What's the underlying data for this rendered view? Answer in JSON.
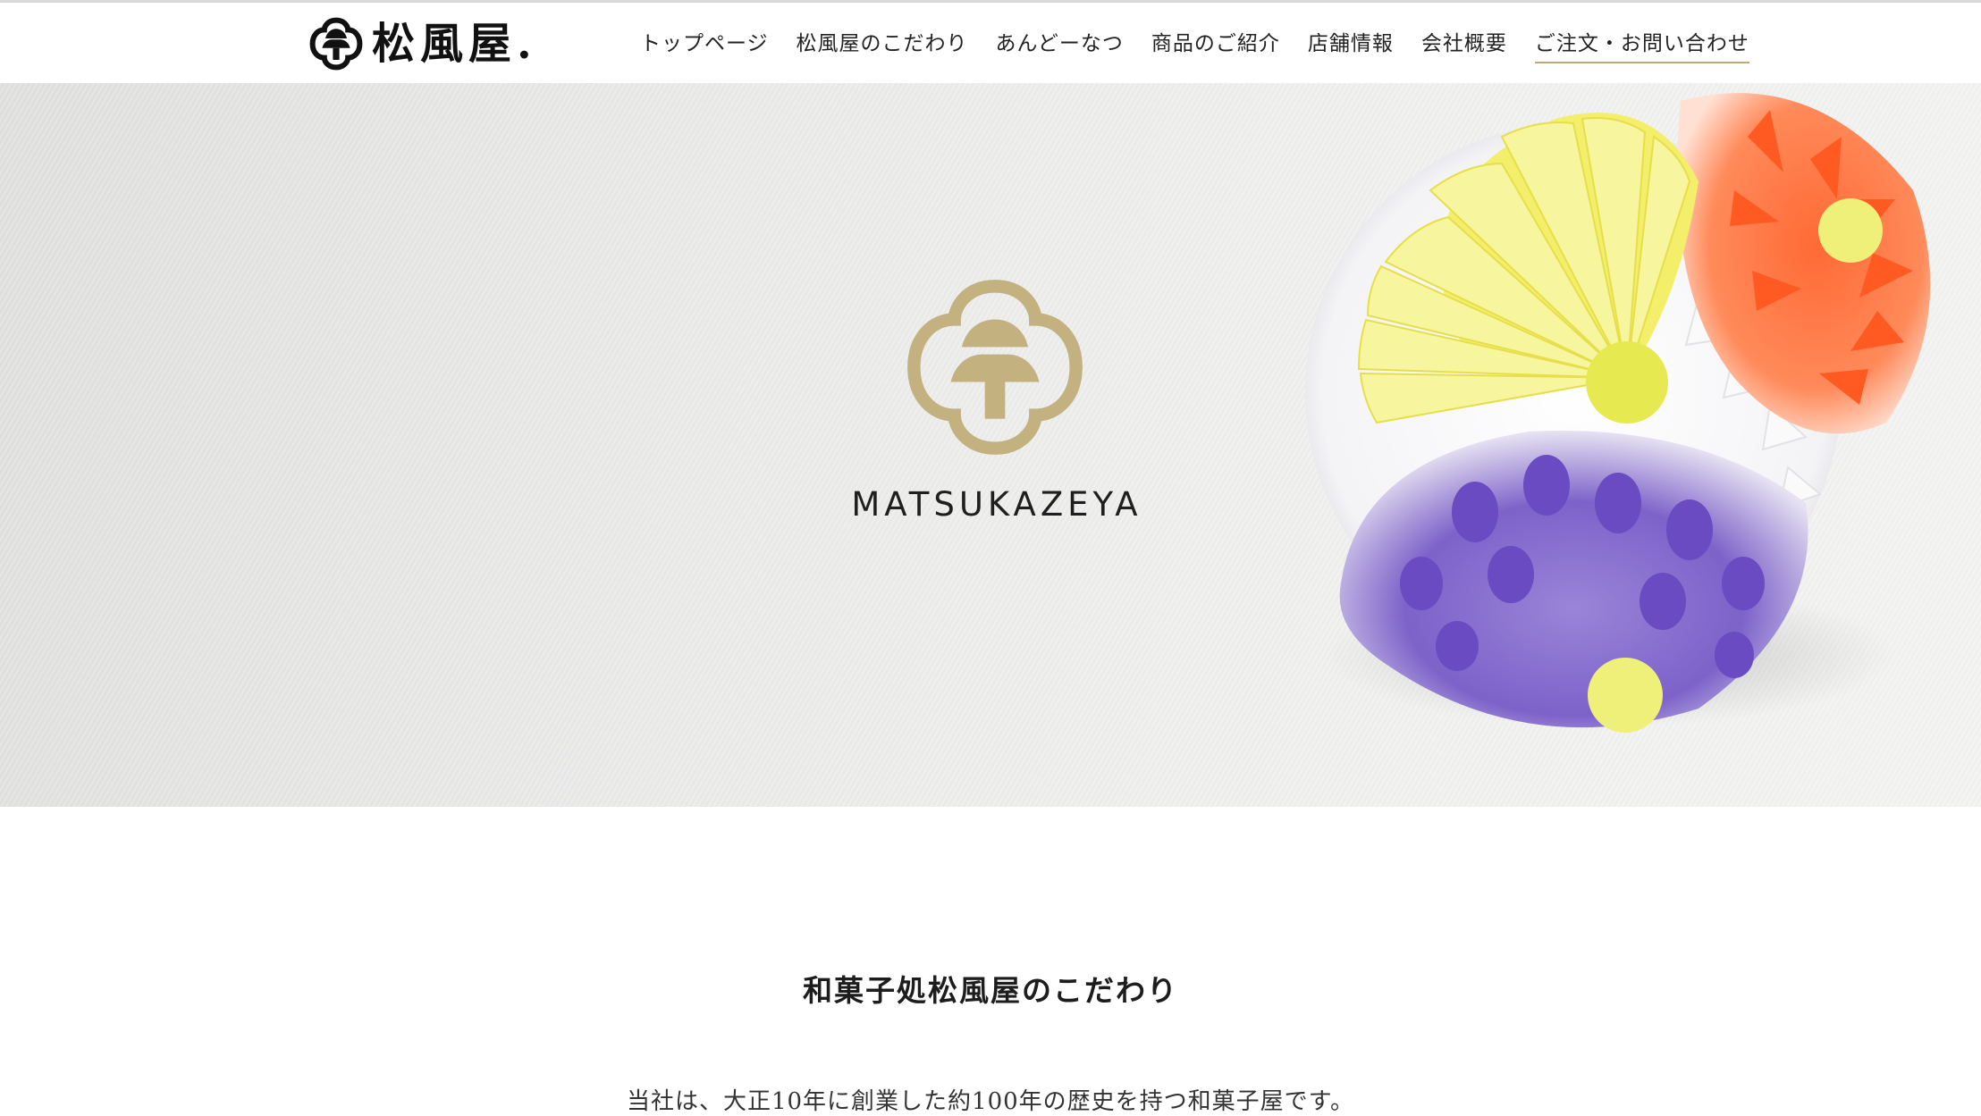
{
  "header": {
    "logo_text": "松風屋.",
    "nav": [
      {
        "label": "トップページ"
      },
      {
        "label": "松風屋のこだわり"
      },
      {
        "label": "あんどーなつ"
      },
      {
        "label": "商品のご紹介"
      },
      {
        "label": "店舗情報"
      },
      {
        "label": "会社概要"
      },
      {
        "label": "ご注文・お問い合わせ"
      }
    ]
  },
  "hero": {
    "brand": "MATSUKAZEYA",
    "emblem_color": "#c3b17f"
  },
  "section": {
    "title": "和菓子処松風屋のこだわり",
    "intro": "当社は、大正10年に創業した約100年の歴史を持つ和菓子屋です。"
  }
}
